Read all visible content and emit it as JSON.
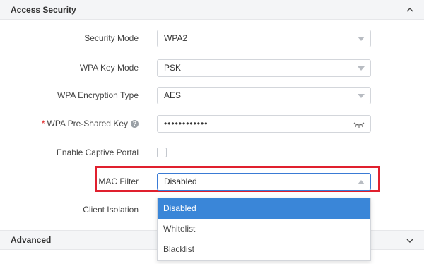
{
  "sections": {
    "access_security": "Access Security",
    "advanced": "Advanced"
  },
  "form": {
    "security_mode": {
      "label": "Security Mode",
      "value": "WPA2"
    },
    "wpa_key_mode": {
      "label": "WPA Key Mode",
      "value": "PSK"
    },
    "wpa_encryption_type": {
      "label": "WPA Encryption Type",
      "value": "AES"
    },
    "wpa_psk": {
      "required_mark": "*",
      "label": "WPA Pre-Shared Key",
      "help": "?",
      "value": "••••••••••••"
    },
    "captive_portal": {
      "label": "Enable Captive Portal",
      "checked": false
    },
    "mac_filter": {
      "label": "MAC Filter",
      "value": "Disabled"
    },
    "client_isolation": {
      "label": "Client Isolation"
    }
  },
  "mac_filter_options": [
    "Disabled",
    "Whitelist",
    "Blacklist"
  ],
  "colors": {
    "highlight_border": "#e0202e",
    "selected_option": "#3a86d8",
    "required": "#e02020"
  },
  "icons": {
    "collapse": "chevron-up-icon",
    "expand": "chevron-down-icon",
    "select": "caret-down-icon",
    "password": "eye-closed-icon"
  }
}
